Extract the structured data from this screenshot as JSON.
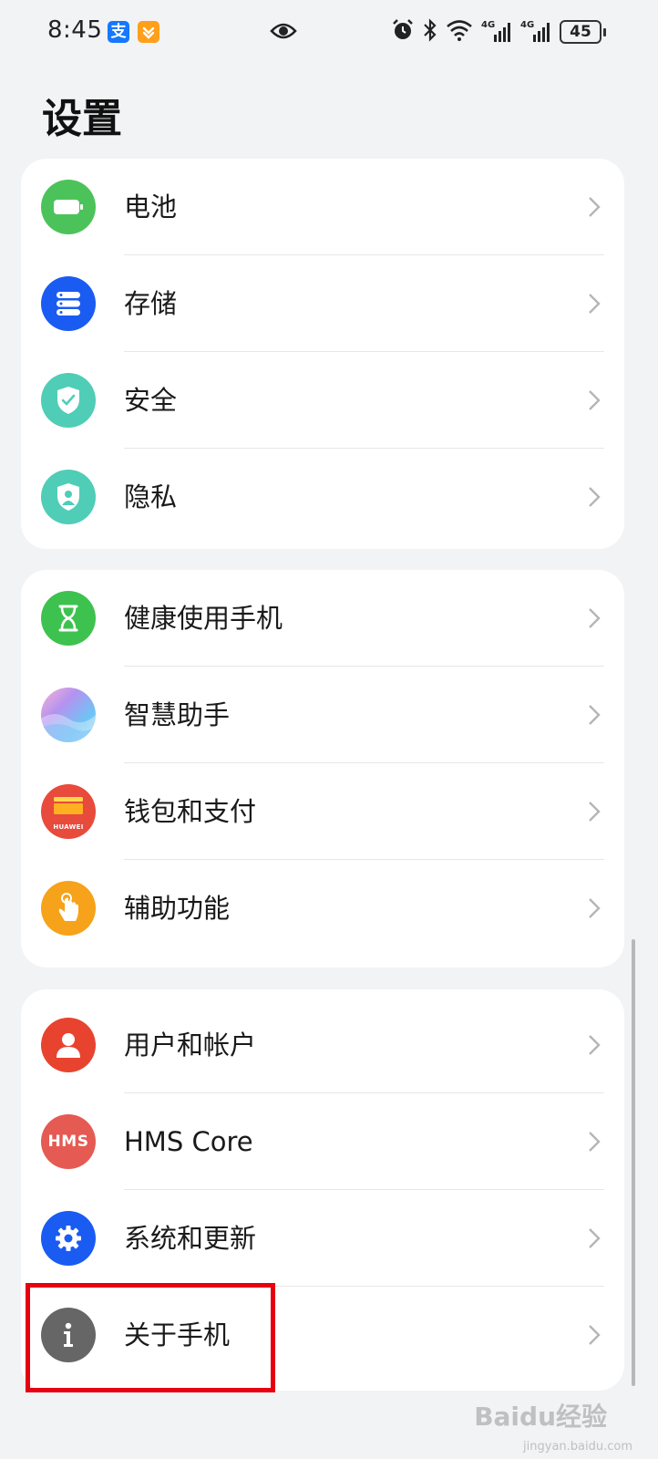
{
  "status_bar": {
    "time": "8:45",
    "app_badge_1": "支",
    "battery": "45",
    "net1": "4G",
    "net2": "4G"
  },
  "page": {
    "title": "设置"
  },
  "groups": [
    {
      "items": [
        {
          "label": "电池",
          "icon": "battery-icon",
          "color": "#4cc35a"
        },
        {
          "label": "存储",
          "icon": "storage-icon",
          "color": "#1a5bf2"
        },
        {
          "label": "安全",
          "icon": "security-shield-icon",
          "color": "#4fcdb7"
        },
        {
          "label": "隐私",
          "icon": "privacy-shield-icon",
          "color": "#4fcdb7"
        }
      ]
    },
    {
      "items": [
        {
          "label": "健康使用手机",
          "icon": "hourglass-icon",
          "color": "#3ec24f"
        },
        {
          "label": "智慧助手",
          "icon": "assistant-orb-icon",
          "color": "#9bb6f6"
        },
        {
          "label": "钱包和支付",
          "icon": "wallet-icon",
          "color": "#e84a3c"
        },
        {
          "label": "辅助功能",
          "icon": "accessibility-hand-icon",
          "color": "#f6a21a"
        }
      ]
    },
    {
      "items": [
        {
          "label": "用户和帐户",
          "icon": "user-icon",
          "color": "#e8432f"
        },
        {
          "label": "HMS Core",
          "icon": "hms-icon",
          "color": "#e55a53"
        },
        {
          "label": "系统和更新",
          "icon": "gear-icon",
          "color": "#1a5bf2"
        },
        {
          "label": "关于手机",
          "icon": "info-icon",
          "color": "#666666"
        }
      ]
    }
  ],
  "icon_text": {
    "hms": "HMS",
    "wallet_brand": "HUAWEI"
  },
  "watermark": {
    "brand": "Baidu经验",
    "url": "jingyan.baidu.com"
  },
  "highlight_color": "#e60012"
}
